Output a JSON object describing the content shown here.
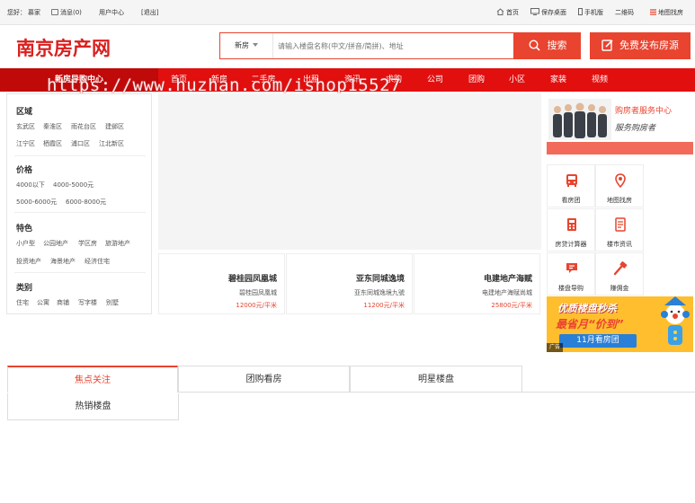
{
  "topbar": {
    "greeting": "您好：",
    "username": "慕家",
    "messages": "消息(0)",
    "user_center": "用户中心",
    "logout": "[退出]",
    "home": "首页",
    "save_desktop": "保存桌面",
    "mobile": "手机版",
    "qrcode": "二维码",
    "map_search": "地图找房"
  },
  "header": {
    "logo_text": "南京房产网",
    "search_category": "新房",
    "search_placeholder": "请输入楼盘名称(中文/拼音/简拼)、地址",
    "search_button": "搜索",
    "publish_button": "免费发布房源"
  },
  "nav": {
    "guide": "新房导购中心",
    "items": [
      "首页",
      "新房",
      "二手房",
      "出租",
      "资讯",
      "求购",
      "公司",
      "团购",
      "小区",
      "家装",
      "视频"
    ]
  },
  "watermark": "https://www.huzhan.com/ishop15527",
  "filters": {
    "region_title": "区域",
    "regions": [
      "玄武区",
      "秦淮区",
      "雨花台区",
      "建邺区",
      "江宁区",
      "栖霞区",
      "浦口区",
      "江北新区"
    ],
    "price_title": "价格",
    "prices": [
      "4000以下",
      "4000-5000元",
      "5000-6000元",
      "6000-8000元"
    ],
    "feature_title": "特色",
    "features": [
      "小户型",
      "公园地产",
      "学区房",
      "旅游地产",
      "投资地产",
      "海景地产",
      "经济住宅"
    ],
    "type_title": "类别",
    "types": [
      "住宅",
      "公寓",
      "商铺",
      "写字楼",
      "别墅"
    ]
  },
  "projects": [
    {
      "name": "碧桂园凤凰城",
      "address": "碧桂园凤凰城",
      "price": "12000元/平米"
    },
    {
      "name": "亚东同城逸境",
      "address": "亚东同城逸境九號",
      "price": "11200元/平米"
    },
    {
      "name": "电建地产海赋",
      "address": "电建地产海赋尚城",
      "price": "25800元/平米"
    }
  ],
  "service": {
    "title": "购房者服务中心",
    "subtitle": "服务购房者",
    "items": [
      {
        "label": "看房团",
        "icon": "bus-icon"
      },
      {
        "label": "地图找房",
        "icon": "map-pin-icon"
      },
      {
        "label": "房贷计算器",
        "icon": "calculator-icon"
      },
      {
        "label": "楼市资讯",
        "icon": "news-icon"
      },
      {
        "label": "楼盘导购",
        "icon": "guide-icon"
      },
      {
        "label": "赚佣金",
        "icon": "hammer-icon"
      }
    ]
  },
  "ad": {
    "line1": "优质楼盘秒杀",
    "line2": "最省月“价到”",
    "button": "11月看房团",
    "tag": "广告"
  },
  "tabs": [
    "焦点关注",
    "团购看房",
    "明星楼盘",
    "热销楼盘"
  ],
  "colors": {
    "brand_red": "#e8442f",
    "nav_red": "#e20f0f",
    "nav_dark": "#c00909",
    "ad_yellow": "#ffbe2e"
  }
}
